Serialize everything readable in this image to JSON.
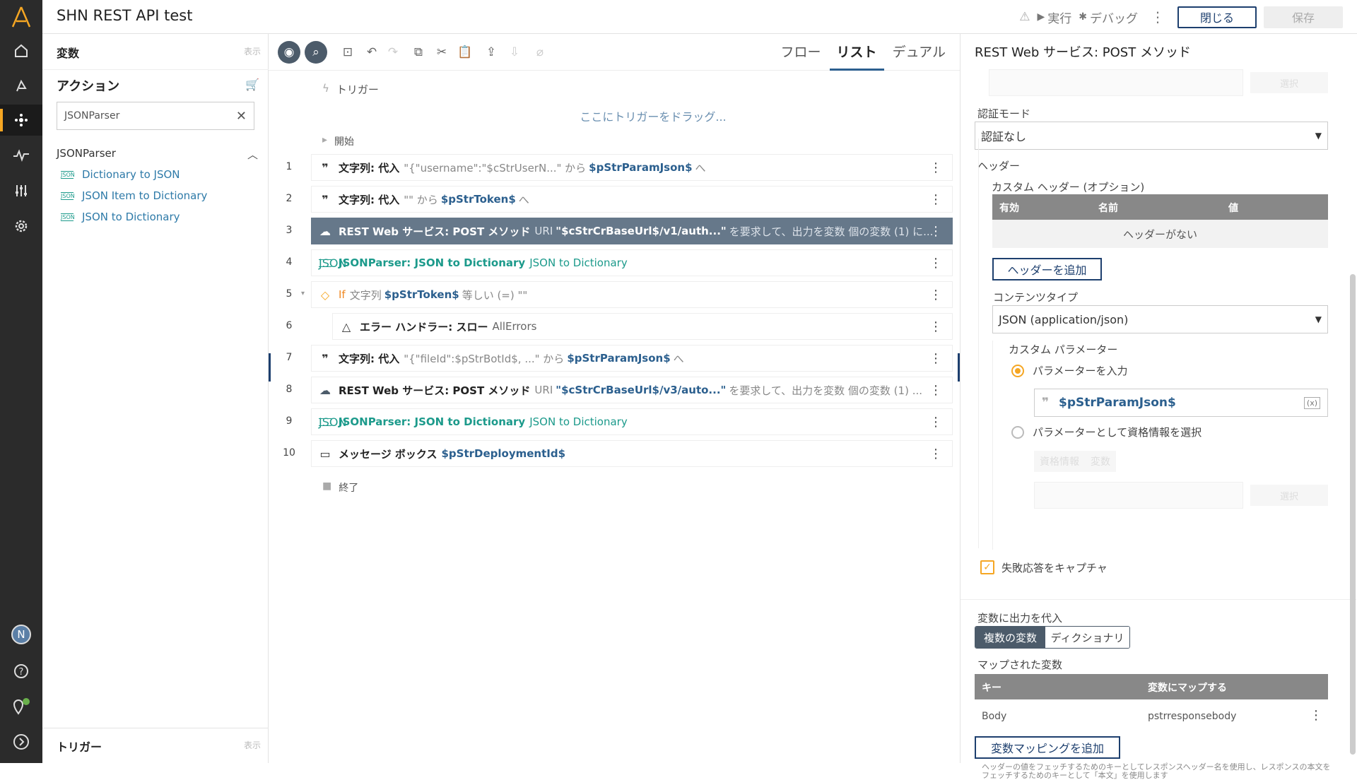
{
  "app": {
    "title": "SHN REST API test"
  },
  "topbar": {
    "run_label": "実行",
    "debug_label": "デバッグ",
    "close_label": "閉じる",
    "save_label": "保存"
  },
  "rail": {
    "user_initial": "N"
  },
  "left": {
    "variables_title": "変数",
    "variables_show": "表示",
    "actions_title": "アクション",
    "search_value": "JSONParser",
    "group_title": "JSONParser",
    "items": [
      "Dictionary to JSON",
      "JSON Item to Dictionary",
      "JSON to Dictionary"
    ],
    "triggers_title": "トリガー",
    "triggers_show": "表示"
  },
  "center": {
    "tabs": [
      "フロー",
      "リスト",
      "デュアル"
    ],
    "trigger_label": "トリガー",
    "trigger_drop": "ここにトリガーをドラッグ...",
    "start_label": "開始",
    "end_label": "終了",
    "lines": [
      {
        "n": "1",
        "kw": "文字列: 代入",
        "g1": "\"{\"username\":\"$cStrUserN...\" から",
        "v1": "$pStrParamJson$",
        "g2": "へ"
      },
      {
        "n": "2",
        "kw": "文字列: 代入",
        "g1": "\"\" から",
        "v1": "$pStrToken$",
        "g2": "へ"
      },
      {
        "n": "3",
        "kw": "REST Web サービス: POST メソッド",
        "g1": "URI",
        "v1": "\"$cStrCrBaseUrl$/v1/auth...\"",
        "g2": "を要求して、出力を変数 個の変数 (1) に..."
      },
      {
        "n": "4",
        "kw": "JSONParser: JSON to Dictionary",
        "g1": "JSON to Dictionary"
      },
      {
        "n": "5",
        "kw": "If",
        "g1": "文字列",
        "v1": "$pStrToken$",
        "g2": "等しい (=) \"\""
      },
      {
        "n": "6",
        "kw": "エラー ハンドラー: スロー",
        "g1": "AllErrors"
      },
      {
        "n": "7",
        "kw": "文字列: 代入",
        "g1": "\"{\"fileId\":$pStrBotId$, ...\" から",
        "v1": "$pStrParamJson$",
        "g2": "へ"
      },
      {
        "n": "8",
        "kw": "REST Web サービス: POST メソッド",
        "g1": "URI",
        "v1": "\"$cStrCrBaseUrl$/v3/auto...\"",
        "g2": "を要求して、出力を変数 個の変数 (1) ..."
      },
      {
        "n": "9",
        "kw": "JSONParser: JSON to Dictionary",
        "g1": "JSON to Dictionary"
      },
      {
        "n": "10",
        "kw": "メッセージ ボックス",
        "v1": "$pStrDeploymentId$"
      }
    ]
  },
  "panel": {
    "title": "REST Web サービス: POST メソッド",
    "select_faded": "選択",
    "auth_label": "認証モード",
    "auth_value": "認証なし",
    "header_label": "ヘッダー",
    "custom_header_label": "カスタム ヘッダー (オプション)",
    "header_cols": [
      "有効",
      "名前",
      "値"
    ],
    "no_header": "ヘッダーがない",
    "add_header": "ヘッダーを追加",
    "content_type_label": "コンテンツタイプ",
    "content_type_value": "JSON (application/json)",
    "custom_param_label": "カスタム パラメーター",
    "radio_enter": "パラメーターを入力",
    "param_value": "$pStrParamJson$",
    "radio_cred": "パラメーターとして資格情報を選択",
    "cred_tab1": "資格情報",
    "cred_tab2": "変数",
    "capture_failed": "失敗応答をキャプチャ",
    "assign_output": "変数に出力を代入",
    "seg_multi": "複数の変数",
    "seg_dict": "ディクショナリ",
    "mapped_label": "マップされた変数",
    "map_cols": [
      "キー",
      "変数にマップする"
    ],
    "map_row": {
      "key": "Body",
      "var": "pstrresponsebody"
    },
    "add_mapping": "変数マッピングを追加",
    "help_text": "ヘッダーの値をフェッチするためのキーとしてレスポンスヘッダー名を使用し、レスポンスの本文をフェッチするためのキーとして「本文」を使用します"
  },
  "colors": {
    "accent": "#f5a623",
    "navy": "#1d3f6e",
    "teal": "#1c9a8b",
    "selected_row": "#66788a"
  }
}
